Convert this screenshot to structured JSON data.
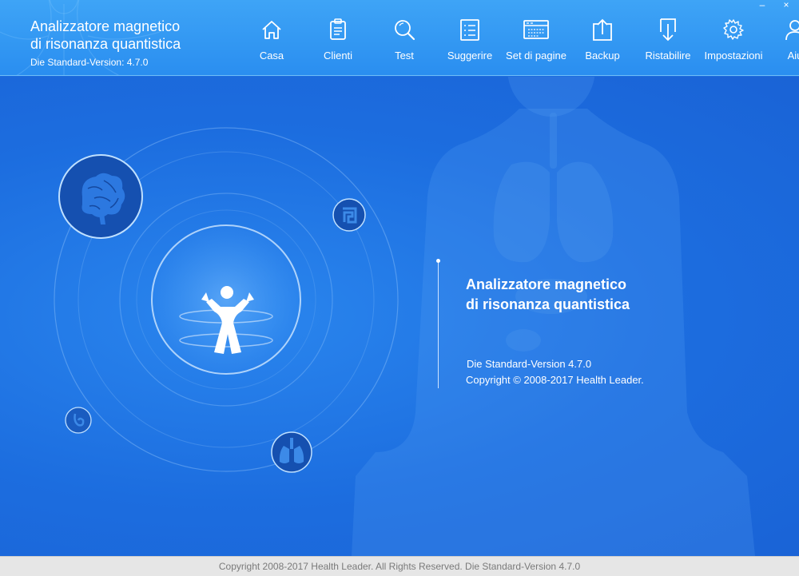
{
  "header": {
    "title_line1": "Analizzatore magnetico",
    "title_line2": "di risonanza quantistica",
    "version": "Die Standard-Version: 4.7.0"
  },
  "nav": [
    {
      "id": "home",
      "label": "Casa",
      "icon": "home-icon"
    },
    {
      "id": "clients",
      "label": "Clienti",
      "icon": "clipboard-icon"
    },
    {
      "id": "test",
      "label": "Test",
      "icon": "search-icon"
    },
    {
      "id": "suggest",
      "label": "Suggerire",
      "icon": "list-icon"
    },
    {
      "id": "page-set",
      "label": "Set di pagine",
      "icon": "window-icon"
    },
    {
      "id": "backup",
      "label": "Backup",
      "icon": "upload-icon"
    },
    {
      "id": "restore",
      "label": "Ristabilire",
      "icon": "download-icon"
    },
    {
      "id": "settings",
      "label": "Impostazioni",
      "icon": "gear-icon"
    },
    {
      "id": "help",
      "label": "Aiu",
      "icon": "user-icon"
    }
  ],
  "window_controls": {
    "minimize": "–",
    "close": "×"
  },
  "splash": {
    "title_line1": "Analizzatore magnetico",
    "title_line2": "di risonanza quantistica",
    "version": "Die Standard-Version 4.7.0",
    "copyright": "Copyright © 2008-2017 Health Leader."
  },
  "orbit_icons": [
    "brain-icon",
    "intestine-icon",
    "stomach-icon",
    "lungs-icon",
    "human-body-icon"
  ],
  "footer": {
    "text": "Copyright 2008-2017 Health Leader. All Rights Reserved.  Die Standard-Version 4.7.0"
  }
}
